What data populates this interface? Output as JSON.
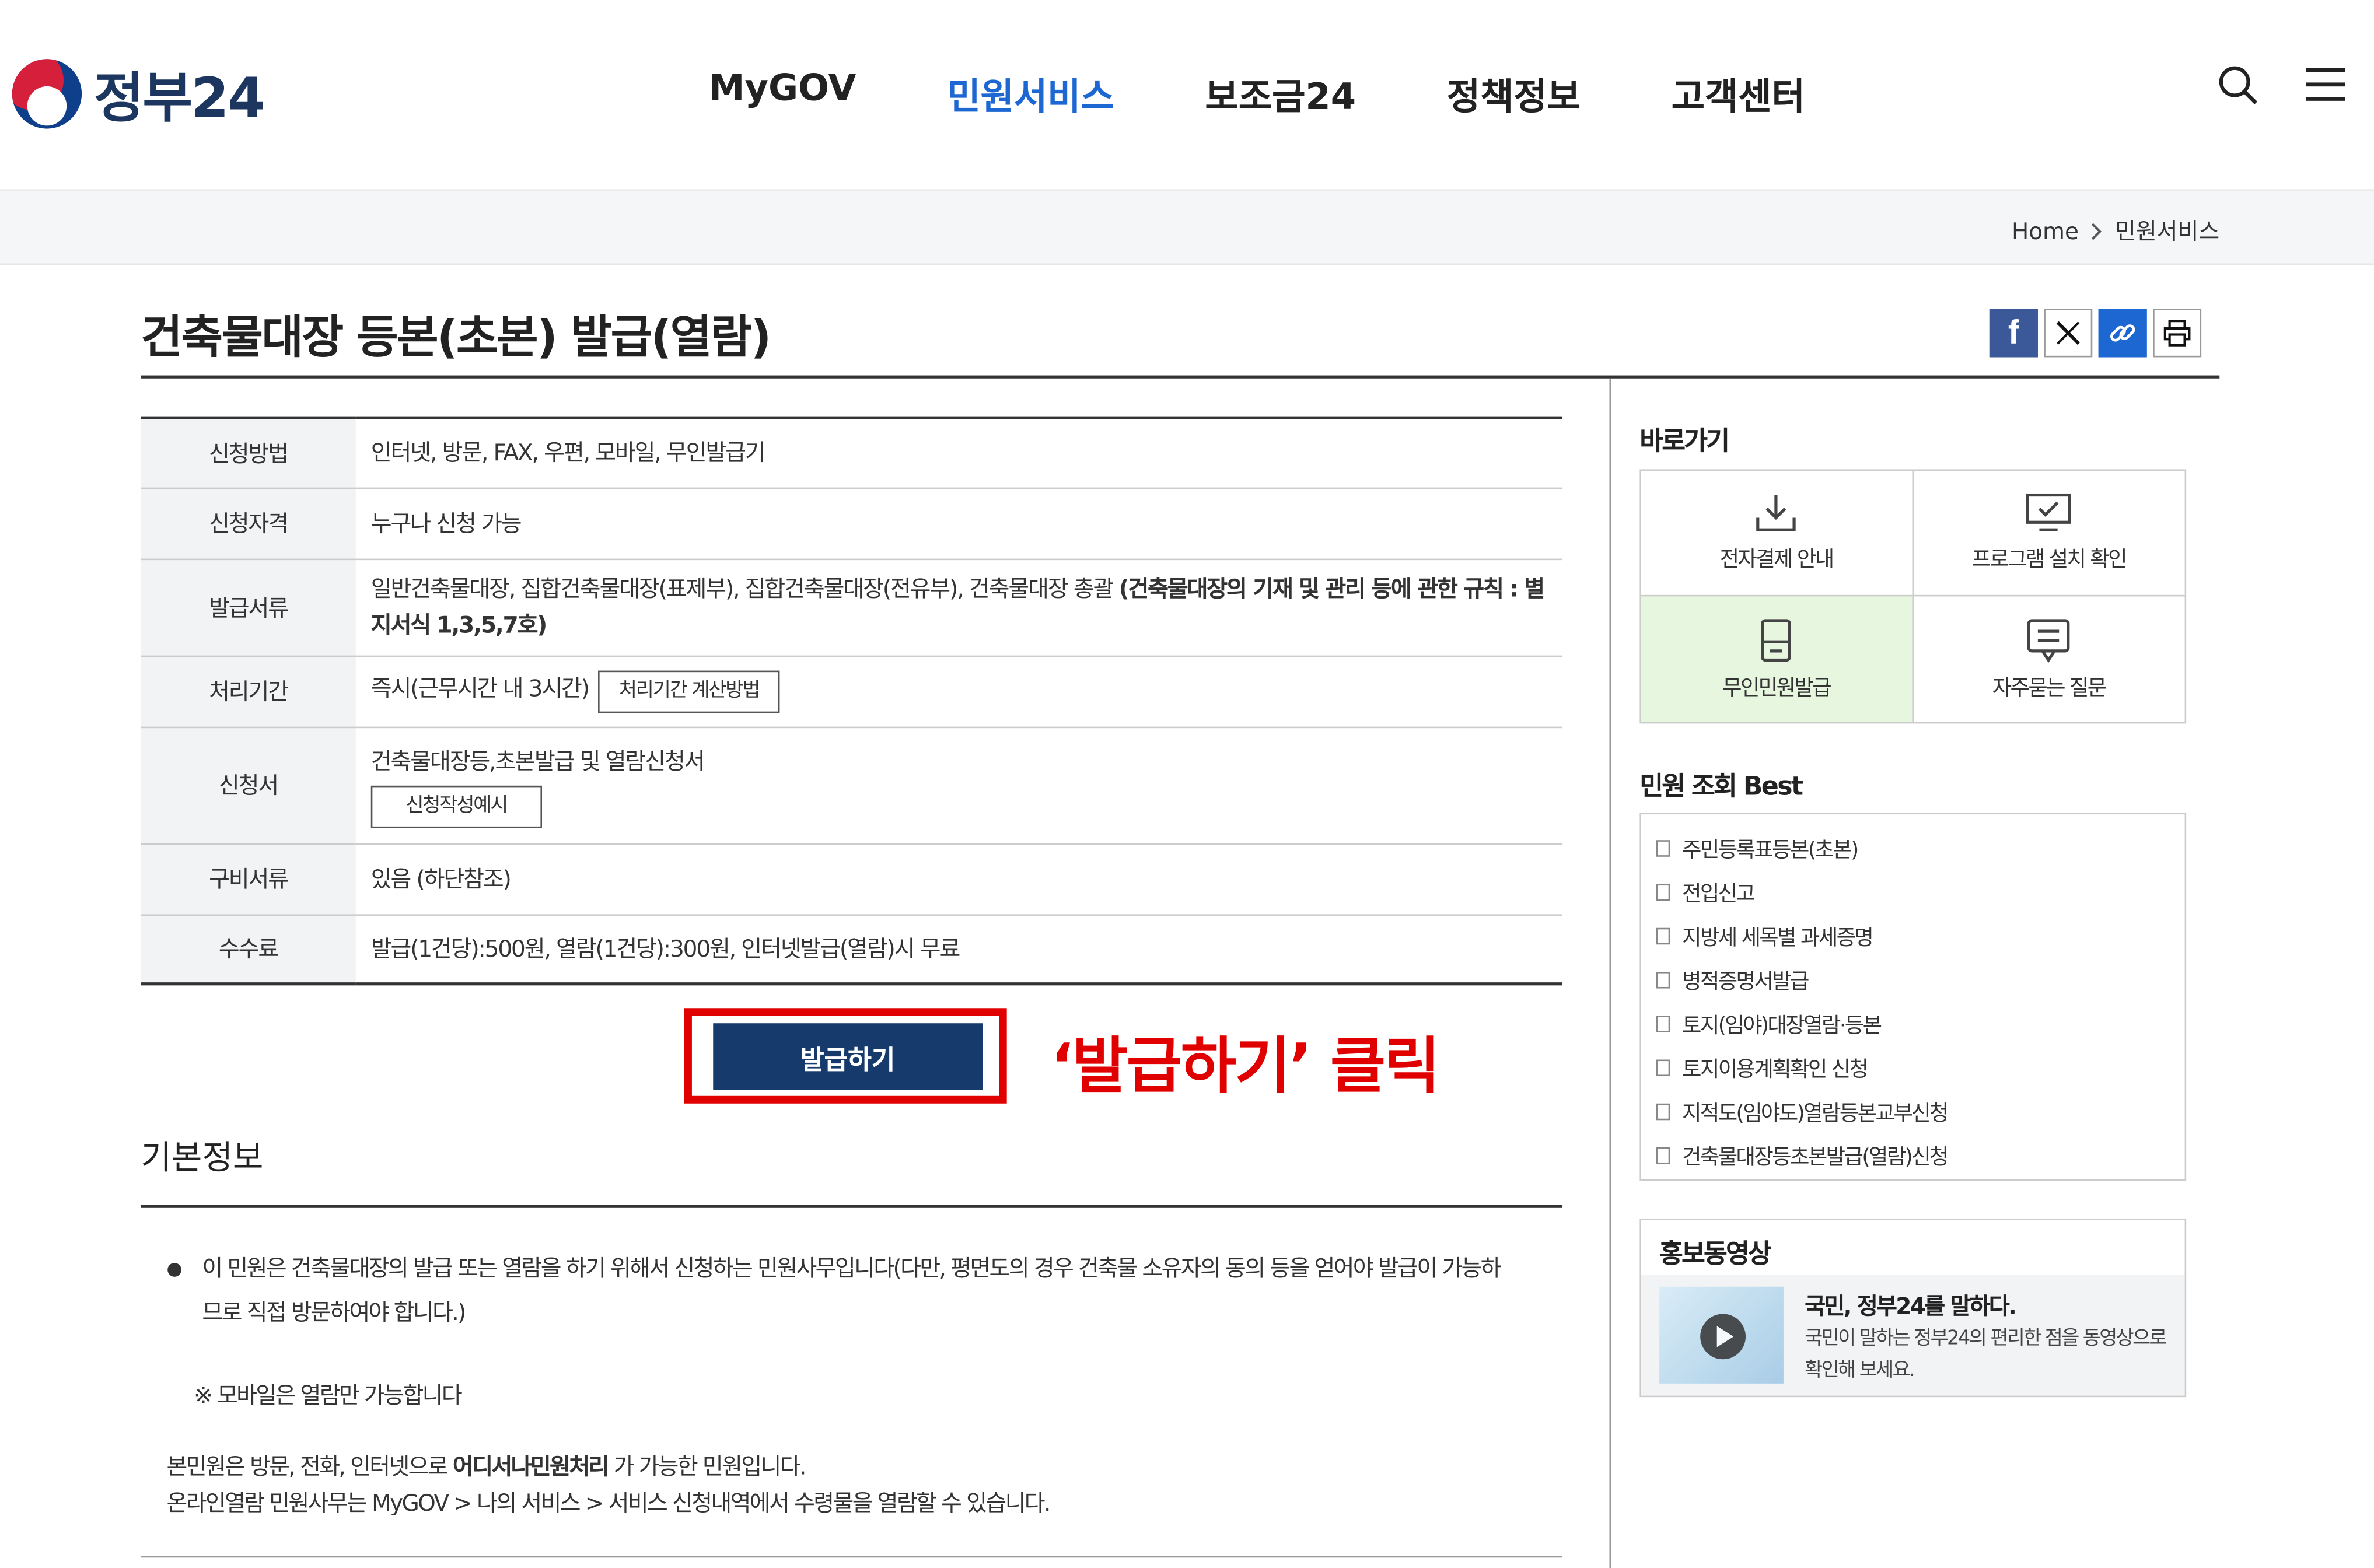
{
  "header": {
    "logo_text": "정부24",
    "nav": [
      "MyGOV",
      "민원서비스",
      "보조금24",
      "정책정보",
      "고객센터"
    ],
    "active_nav": "민원서비스",
    "icons": [
      "search-icon",
      "menu-icon"
    ]
  },
  "breadcrumb": {
    "home": "Home",
    "current": "민원서비스"
  },
  "page_title": "건축물대장 등본(초본) 발급(열람)",
  "share_icons": [
    "facebook-icon",
    "x-icon",
    "link-icon",
    "print-icon"
  ],
  "info": {
    "method": {
      "label": "신청방법",
      "value": "인터넷, 방문, FAX, 우편, 모바일, 무인발급기"
    },
    "qualification": {
      "label": "신청자격",
      "value": "누구나 신청 가능"
    },
    "documents": {
      "label": "발급서류",
      "value": "일반건축물대장, 집합건축물대장(표제부), 집합건축물대장(전유부), 건축물대장 총괄 ",
      "bold": "(건축물대장의 기재 및 관리 등에 관한 규칙 : 별지서식 1,3,5,7호)"
    },
    "period": {
      "label": "처리기간",
      "value": "즉시(근무시간 내 3시간)",
      "button": "처리기간 계산방법"
    },
    "form": {
      "label": "신청서",
      "value": "건축물대장등,초본발급 및 열람신청서",
      "button": "신청작성예시"
    },
    "required": {
      "label": "구비서류",
      "value": "있음 (하단참조)"
    },
    "fee": {
      "label": "수수료",
      "value": "발급(1건당):500원, 열람(1건당):300원, 인터넷발급(열람)시 무료"
    }
  },
  "issue_button": "발급하기",
  "annotation": "‘발급하기’ 클릭",
  "basic_info": {
    "title": "기본정보",
    "bullet": "이 민원은 건축물대장의 발급 또는 열람을 하기 위해서 신청하는 민원사무입니다(다만, 평면도의 경우 건축물 소유자의 동의 등을 얻어야 발급이 가능하므로 직접 방문하여야 합니다.)",
    "mobile_note": "※ 모바일은 열람만 가능합니다",
    "line1_pre": "본민원은 방문, 전화, 인터넷으로 ",
    "line1_bold": "어디서나민원처리",
    "line1_post": " 가 가능한 민원입니다.",
    "line2": "온라인열람 민원사무는 MyGOV > 나의 서비스 > 서비스 신청내역에서 수령물을 열람할 수 있습니다."
  },
  "sidebar": {
    "quick_title": "바로가기",
    "quick": [
      {
        "label": "전자결제 안내",
        "icon": "download-icon"
      },
      {
        "label": "프로그램 설치 확인",
        "icon": "monitor-check-icon"
      },
      {
        "label": "무인민원발급",
        "icon": "kiosk-icon"
      },
      {
        "label": "자주묻는 질문",
        "icon": "chat-icon"
      }
    ],
    "best_title": "민원 조회 Best",
    "best": [
      "주민등록표등본(초본)",
      "전입신고",
      "지방세 세목별 과세증명",
      "병적증명서발급",
      "토지(임야)대장열람·등본",
      "토지이용계획확인 신청",
      "지적도(임야도)열람등본교부신청",
      "건축물대장등초본발급(열람)신청"
    ],
    "promo_title": "홍보동영상",
    "promo_heading": "국민, 정부24를 말하다.",
    "promo_desc": "국민이 말하는 정부24의 편리한 점을 동영상으로 확인해 보세요."
  }
}
